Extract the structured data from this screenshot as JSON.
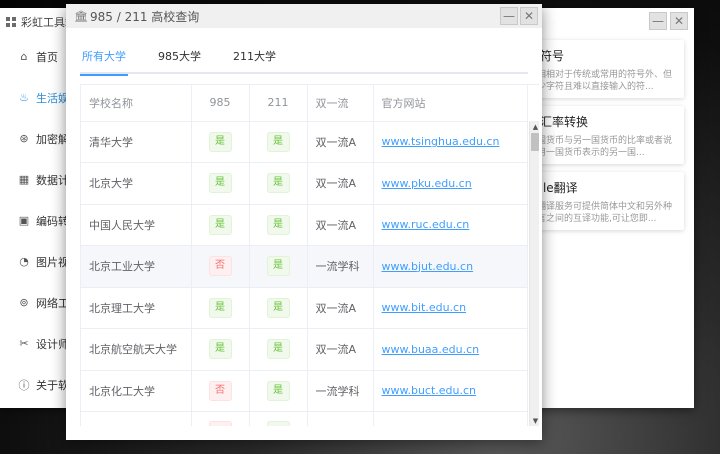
{
  "main_window": {
    "title": "彩虹工具箱",
    "sidebar": [
      {
        "label": "首页",
        "icon": "home-icon"
      },
      {
        "label": "生活娱",
        "icon": "life-icon",
        "active": true
      },
      {
        "label": "加密解",
        "icon": "encrypt-icon"
      },
      {
        "label": "数据计",
        "icon": "calculator-icon"
      },
      {
        "label": "编码转",
        "icon": "code-icon"
      },
      {
        "label": "图片视",
        "icon": "image-icon"
      },
      {
        "label": "网络工",
        "icon": "network-icon"
      },
      {
        "label": "设计师",
        "icon": "design-icon"
      },
      {
        "label": "关于软",
        "icon": "info-icon"
      }
    ],
    "cards": [
      {
        "title": "殊符号",
        "desc": "提相相对于传统或常用的符号外、但更少字符且难以直接输入的符..."
      },
      {
        "title": "门汇率转换",
        "desc": "一国货币与另一国货币的比率或者说是用一国货币表示的另一国..."
      },
      {
        "title": "ogle翻译",
        "desc": "的翻译服务可提供简体中文和另外种语言之间的互译功能,可让您即..."
      }
    ]
  },
  "dialog": {
    "title": "985 / 211 高校查询",
    "tabs": [
      "所有大学",
      "985大学",
      "211大学"
    ],
    "active_tab": 0,
    "columns": [
      "学校名称",
      "985",
      "211",
      "双一流",
      "官方网站"
    ],
    "rows": [
      {
        "name": "清华大学",
        "is985": "是",
        "is211": "是",
        "double": "双一流A",
        "site": "www.tsinghua.edu.cn"
      },
      {
        "name": "北京大学",
        "is985": "是",
        "is211": "是",
        "double": "双一流A",
        "site": "www.pku.edu.cn"
      },
      {
        "name": "中国人民大学",
        "is985": "是",
        "is211": "是",
        "double": "双一流A",
        "site": "www.ruc.edu.cn"
      },
      {
        "name": "北京工业大学",
        "is985": "否",
        "is211": "是",
        "double": "一流学科",
        "site": "www.bjut.edu.cn",
        "highlight": true
      },
      {
        "name": "北京理工大学",
        "is985": "是",
        "is211": "是",
        "double": "双一流A",
        "site": "www.bit.edu.cn"
      },
      {
        "name": "北京航空航天大学",
        "is985": "是",
        "is211": "是",
        "double": "双一流A",
        "site": "www.buaa.edu.cn"
      },
      {
        "name": "北京化工大学",
        "is985": "否",
        "is211": "是",
        "double": "一流学科",
        "site": "www.buct.edu.cn"
      }
    ]
  },
  "controls": {
    "minimize": "—",
    "close": "✕"
  },
  "colors": {
    "accent": "#409eff",
    "yes_text": "#67c23a",
    "no_text": "#f56c6c",
    "sidebar_active": "#2a8cd8"
  }
}
